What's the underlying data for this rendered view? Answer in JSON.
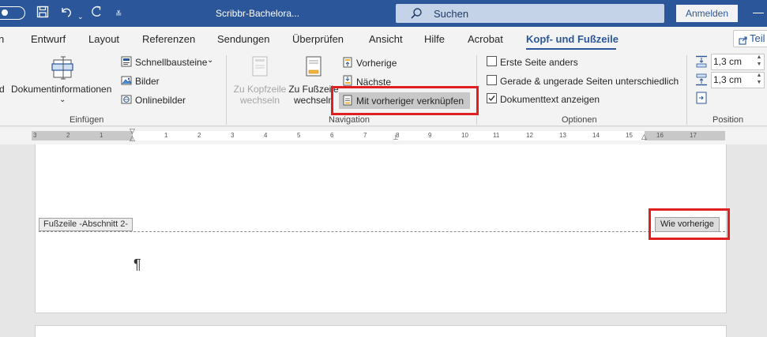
{
  "titlebar": {
    "doc_title": "Scribbr-Bachelora...",
    "search_label": "Suchen",
    "signin_label": "Anmelden"
  },
  "tabs": [
    {
      "label": "n"
    },
    {
      "label": "Entwurf"
    },
    {
      "label": "Layout"
    },
    {
      "label": "Referenzen"
    },
    {
      "label": "Sendungen"
    },
    {
      "label": "Überprüfen"
    },
    {
      "label": "Ansicht"
    },
    {
      "label": "Hilfe"
    },
    {
      "label": "Acrobat"
    },
    {
      "label": "Kopf- und Fußzeile"
    }
  ],
  "share_label": "Teil",
  "ribbon": {
    "insert": {
      "cut_label": "d",
      "docinfo_label": "Dokumentinformationen",
      "docinfo_arrow": "⌄",
      "quickparts_label": "Schnellbausteine",
      "quickparts_arrow": "⌄",
      "pictures_label": "Bilder",
      "online_pictures_label": "Onlinebilder",
      "group_label": "Einfügen"
    },
    "navigation": {
      "goto_header_line1": "Zu Kopfzeile",
      "goto_header_line2": "wechseln",
      "goto_footer_line1": "Zu Fußzeile",
      "goto_footer_line2": "wechseln",
      "previous_label": "Vorherige",
      "next_label": "Nächste",
      "link_previous_label": "Mit vorheriger verknüpfen",
      "group_label": "Navigation"
    },
    "options": {
      "different_first_label": "Erste Seite anders",
      "different_first_checked": false,
      "odd_even_label": "Gerade & ungerade Seiten unterschiedlich",
      "odd_even_checked": false,
      "show_doc_text_label": "Dokumenttext anzeigen",
      "show_doc_text_checked": true,
      "group_label": "Optionen"
    },
    "position": {
      "header_from_top": "1,3 cm",
      "footer_from_bottom": "1,3 cm",
      "group_label": "Position"
    }
  },
  "ruler": {
    "numbers": [
      "3",
      "2",
      "1",
      "1",
      "2",
      "3",
      "4",
      "5",
      "6",
      "7",
      "8",
      "9",
      "10",
      "11",
      "12",
      "13",
      "14",
      "15",
      "16",
      "17"
    ]
  },
  "page": {
    "footer_label": "Fußzeile -Abschnitt 2-",
    "same_as_previous_label": "Wie vorherige",
    "paragraph_mark": "¶"
  },
  "colors": {
    "accent": "#2b579a",
    "highlight_red": "#e02020"
  }
}
